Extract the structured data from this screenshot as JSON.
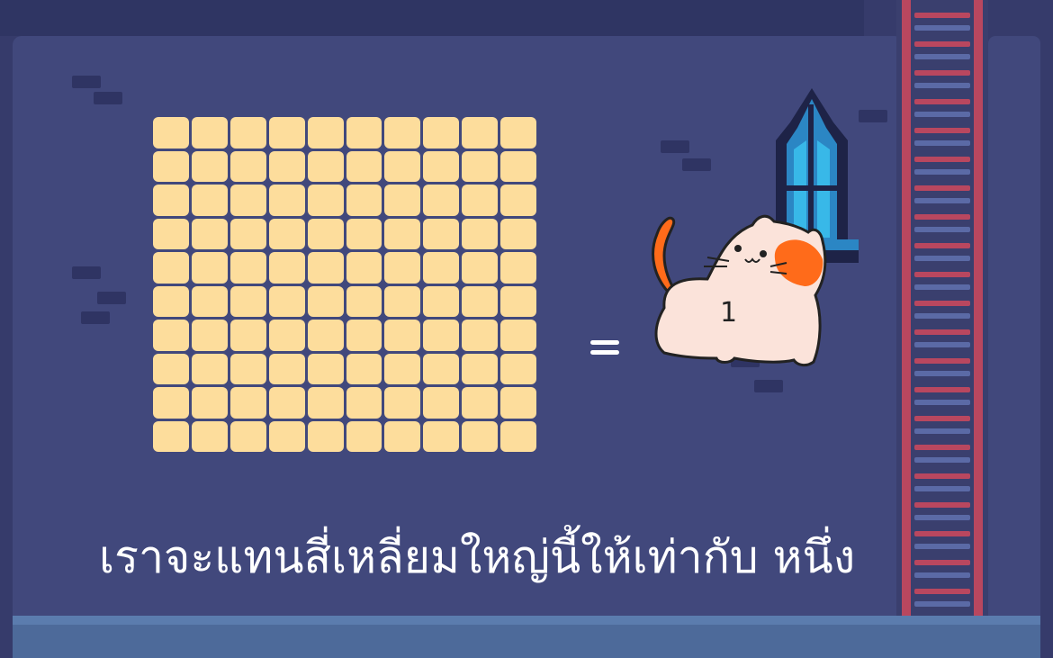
{
  "scene": {
    "caption": "เราจะแทนสี่เหลี่ยมใหญ่นี้ให้เท่ากับ หนึ่ง",
    "cat_label": "1",
    "grid": {
      "rows": 10,
      "columns": 10
    },
    "colors": {
      "background": "#363b6b",
      "wall": "#41487c",
      "tile": "#fddd9c",
      "ladder": "#b9475f",
      "floor": "#4d6a9a",
      "cat_body": "#fbe3da",
      "cat_patch": "#ff6b1a",
      "window_glass": "#38b8e8"
    },
    "icons": {
      "cat": "calico-cat-icon",
      "window": "gothic-window-icon",
      "ladder": "ladder-icon",
      "equals": "equals-sign-icon"
    }
  }
}
